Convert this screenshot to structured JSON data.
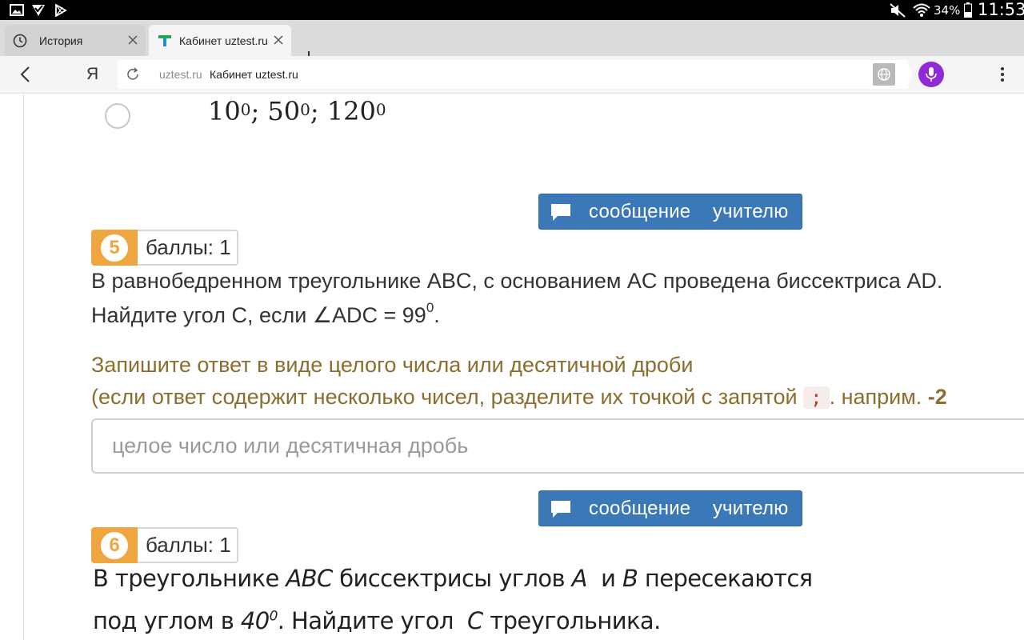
{
  "status_bar": {
    "battery": "34%",
    "time": "11:53",
    "left_icons": [
      "image-icon",
      "checkmark-badge-icon",
      "play-store-icon"
    ],
    "right_icons": [
      "mute-icon",
      "wifi-icon",
      "battery-icon"
    ]
  },
  "tabs": [
    {
      "label": "История",
      "icon": "history-clock-icon",
      "active": false
    },
    {
      "label": "Кабинет uztest.ru",
      "icon": "uztest-favicon",
      "active": true
    }
  ],
  "toolbar": {
    "back_icon": "back-chevron-icon",
    "yandex_label": "Я",
    "reload_icon": "reload-icon",
    "domain": "uztest.ru",
    "page_title": "Кабинет uztest.ru",
    "globe_icon": "globe-icon",
    "voice_icon": "microphone-icon",
    "menu_icon": "kebab-menu-icon"
  },
  "prev_answer_option": {
    "numbers": [
      "10",
      "50",
      "120"
    ],
    "exponent": "0",
    "separator": "; "
  },
  "message_button_label": "сообщение    учителю",
  "question5": {
    "number": "5",
    "points": "баллы: 1",
    "line1": "В равнобедренном треугольнике ABC, с основанием AC проведена биссектриса AD.",
    "line2_prefix": "Найдите угол C, если ∠ADC = 99",
    "line2_sup": "0",
    "line2_suffix": ".",
    "hint_line1": "Запишите ответ в виде целого числа или десятичной дроби",
    "hint_line2_prefix": "(если ответ содержит несколько чисел, разделите их точкой с запятой",
    "hint_code": ";",
    "hint_line2_suffix": ". наприм.",
    "hint_example": "-2",
    "input_placeholder": "целое число или десятичная дробь",
    "input_value": ""
  },
  "question6": {
    "number": "6",
    "points": "баллы: 1",
    "line1_a": "В треугольнике ",
    "line1_abc": "ABC",
    "line1_b": " биссектрисы углов ",
    "line1_A": "A",
    "line1_c": "  и ",
    "line1_B": "B",
    "line1_d": " пересекаются",
    "line2_a": "под углом в ",
    "line2_angle": "40",
    "line2_sup": "0",
    "line2_b": ". Найдите угол  ",
    "line2_C": "C",
    "line2_c": " треугольника."
  }
}
